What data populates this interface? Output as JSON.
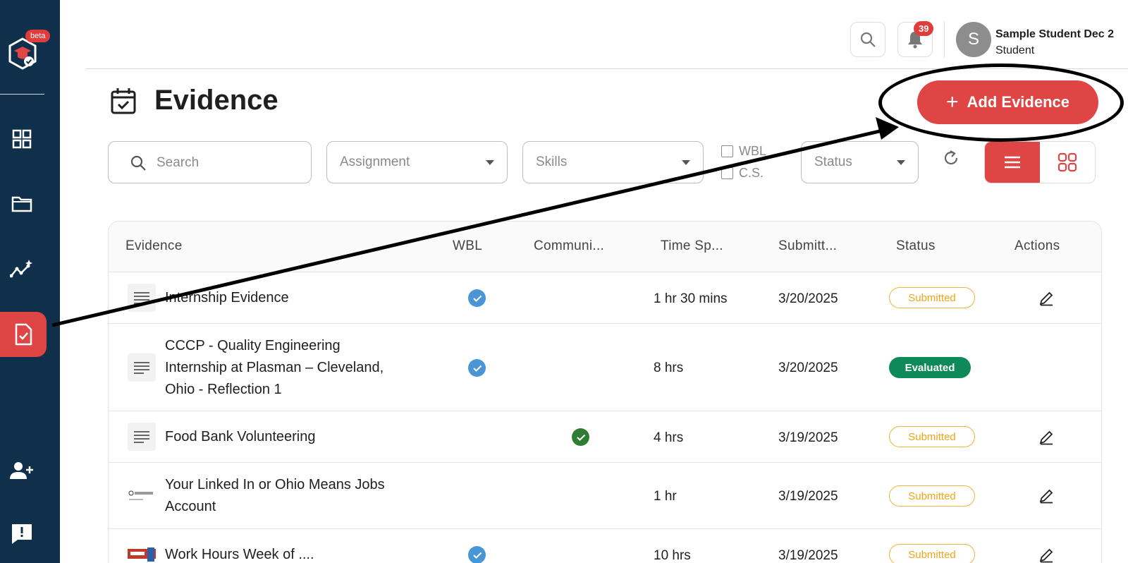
{
  "sidebar": {
    "beta_label": "beta",
    "items": [
      {
        "name": "dashboard",
        "icon": "grid-icon"
      },
      {
        "name": "folder",
        "icon": "folder-icon"
      },
      {
        "name": "progress",
        "icon": "chart-sparkle-icon"
      },
      {
        "name": "evidence",
        "icon": "evidence-check-icon",
        "active": true
      },
      {
        "name": "invite",
        "icon": "add-user-icon"
      },
      {
        "name": "feedback",
        "icon": "feedback-icon"
      }
    ]
  },
  "header": {
    "notification_count": "39",
    "avatar_initial": "S",
    "user_name": "Sample Student Dec 2",
    "user_role": "Student"
  },
  "page": {
    "title": "Evidence",
    "add_button": "Add Evidence",
    "add_button_icon": "+"
  },
  "filters": {
    "search_placeholder": "Search",
    "assignment_placeholder": "Assignment",
    "skills_placeholder": "Skills",
    "wbl_label": "WBL",
    "cs_label": "C.S.",
    "status_placeholder": "Status"
  },
  "table": {
    "headers": [
      "Evidence",
      "WBL",
      "Communi...",
      "Time Sp...",
      "Submitt...",
      "Status",
      "Actions"
    ],
    "rows": [
      {
        "title": "Internship Evidence",
        "wbl": true,
        "community": false,
        "time": "1 hr 30 mins",
        "submitted": "3/20/2025",
        "status": "Submitted",
        "editable": true
      },
      {
        "title": "CCCP - Quality Engineering Internship at Plasman – Cleveland, Ohio - Reflection 1",
        "wbl": true,
        "community": false,
        "time": "8 hrs",
        "submitted": "3/20/2025",
        "status": "Evaluated",
        "editable": false
      },
      {
        "title": "Food Bank Volunteering",
        "wbl": false,
        "community": true,
        "time": "4 hrs",
        "submitted": "3/19/2025",
        "status": "Submitted",
        "editable": true
      },
      {
        "title": "Your Linked In or Ohio Means Jobs Account",
        "wbl": false,
        "community": false,
        "time": "1 hr",
        "submitted": "3/19/2025",
        "status": "Submitted",
        "editable": true
      },
      {
        "title": "Work Hours Week of ....",
        "wbl": true,
        "community": false,
        "time": "10 hrs",
        "submitted": "3/19/2025",
        "status": "Submitted",
        "editable": true
      }
    ]
  },
  "colors": {
    "sidebar_bg": "#0f2f4a",
    "accent": "#e04545",
    "wbl_check": "#4a95d6",
    "community_check": "#2e7d32",
    "submitted": "#f2a516",
    "evaluated": "#0e8a5a"
  }
}
